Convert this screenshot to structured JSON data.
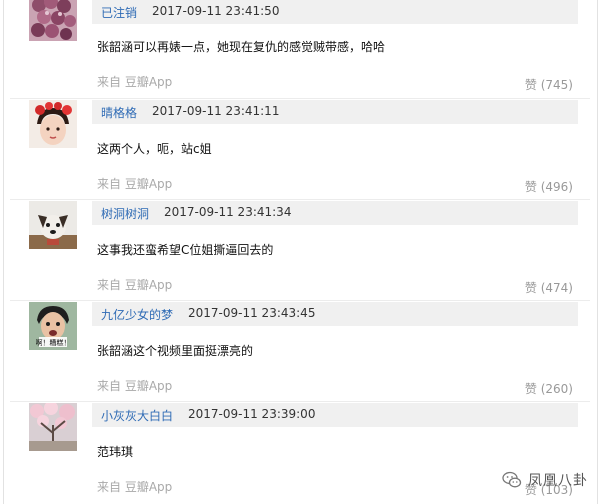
{
  "comments": [
    {
      "username": "已注销",
      "timestamp": "2017-09-11 23:41:50",
      "text": "张韶涵可以再婊一点，她现在复仇的感觉贼带感，哈哈",
      "source": "来自 豆瓣App",
      "likes": "赞 (745)",
      "avatar": "avatar-grapes"
    },
    {
      "username": "晴格格",
      "timestamp": "2017-09-11 23:41:11",
      "text": "这两个人，呃，站c姐",
      "source": "来自 豆瓣App",
      "likes": "赞 (496)",
      "avatar": "avatar-girl-red-flowers"
    },
    {
      "username": "树洞树洞",
      "timestamp": "2017-09-11 23:41:34",
      "text": "这事我还蛮希望C位姐撕逼回去的",
      "source": "来自 豆瓣App",
      "likes": "赞 (474)",
      "avatar": "avatar-dog"
    },
    {
      "username": "九亿少女的梦",
      "timestamp": "2017-09-11 23:43:45",
      "text": "张韶涵这个视频里面挺漂亮的",
      "source": "来自 豆瓣App",
      "likes": "赞 (260)",
      "avatar": "avatar-man-meme",
      "avatar_caption": "啊！糟糕！"
    },
    {
      "username": "小灰灰大白白",
      "timestamp": "2017-09-11 23:39:00",
      "text": "范玮琪",
      "source": "来自 豆瓣App",
      "likes": "赞 (103)",
      "avatar": "avatar-cherry-blossom"
    }
  ],
  "watermark": {
    "text": "凤凰八卦",
    "icon": "wechat-icon"
  }
}
